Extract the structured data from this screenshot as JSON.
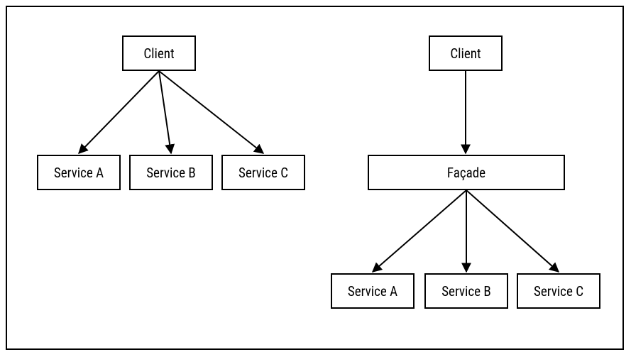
{
  "diagram": {
    "left": {
      "client": "Client",
      "services": [
        "Service A",
        "Service B",
        "Service C"
      ]
    },
    "right": {
      "client": "Client",
      "facade": "Façade",
      "services": [
        "Service A",
        "Service B",
        "Service C"
      ]
    }
  }
}
